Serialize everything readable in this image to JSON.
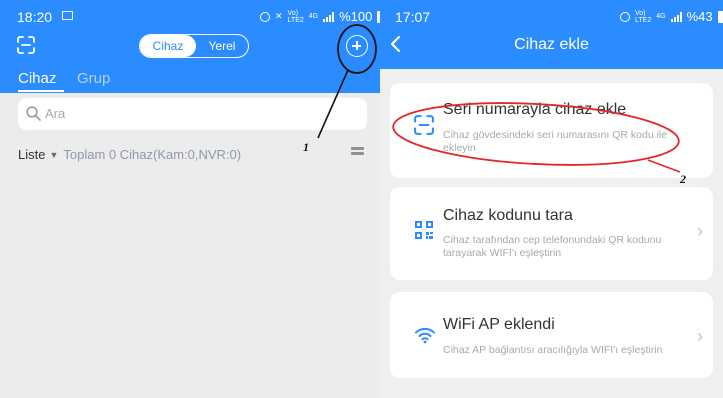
{
  "left": {
    "status": {
      "time": "18:20",
      "signal_lines": [
        "Vo)",
        "LTE2"
      ],
      "network": "4G",
      "battery": "%100"
    },
    "segment": {
      "active": "Cihaz",
      "inactive": "Yerel"
    },
    "tabs": [
      {
        "label": "Cihaz",
        "active": true
      },
      {
        "label": "Grup",
        "active": false
      }
    ],
    "search": {
      "placeholder": "Ara"
    },
    "list": {
      "label": "Liste",
      "summary": "Toplam 0 Cihaz(Kam:0,NVR:0)"
    },
    "icons": {
      "top_left": "scan-icon",
      "top_right": "plus-circle-icon",
      "search": "search-icon",
      "list_menu": "menu-icon"
    }
  },
  "right": {
    "status": {
      "time": "17:07",
      "signal_lines": [
        "Vo)",
        "LTE2"
      ],
      "network": "4G",
      "battery": "%43"
    },
    "title": "Cihaz ekle",
    "options": [
      {
        "title": "Seri numarayla cihaz ekle",
        "desc": "Cihaz gövdesindeki seri numarasını QR kodu ile ekleyin",
        "icon": "scan-icon"
      },
      {
        "title": "Cihaz kodunu tara",
        "desc": "Cihaz tarafından cep telefonundaki QR kodunu tarayarak WIFI'ı eşleştirin",
        "icon": "qr-code-icon"
      },
      {
        "title": "WiFi AP eklendi",
        "desc": "Cihaz AP bağlantısı aracılığıyla WIFI'ı eşleştirin",
        "icon": "wifi-icon"
      }
    ]
  },
  "annotations": {
    "first": "1",
    "second": "2",
    "color": "#111111"
  },
  "colors": {
    "brand": "#2a8cff",
    "muted_text": "#a9a9a9",
    "background": "#efefef"
  }
}
